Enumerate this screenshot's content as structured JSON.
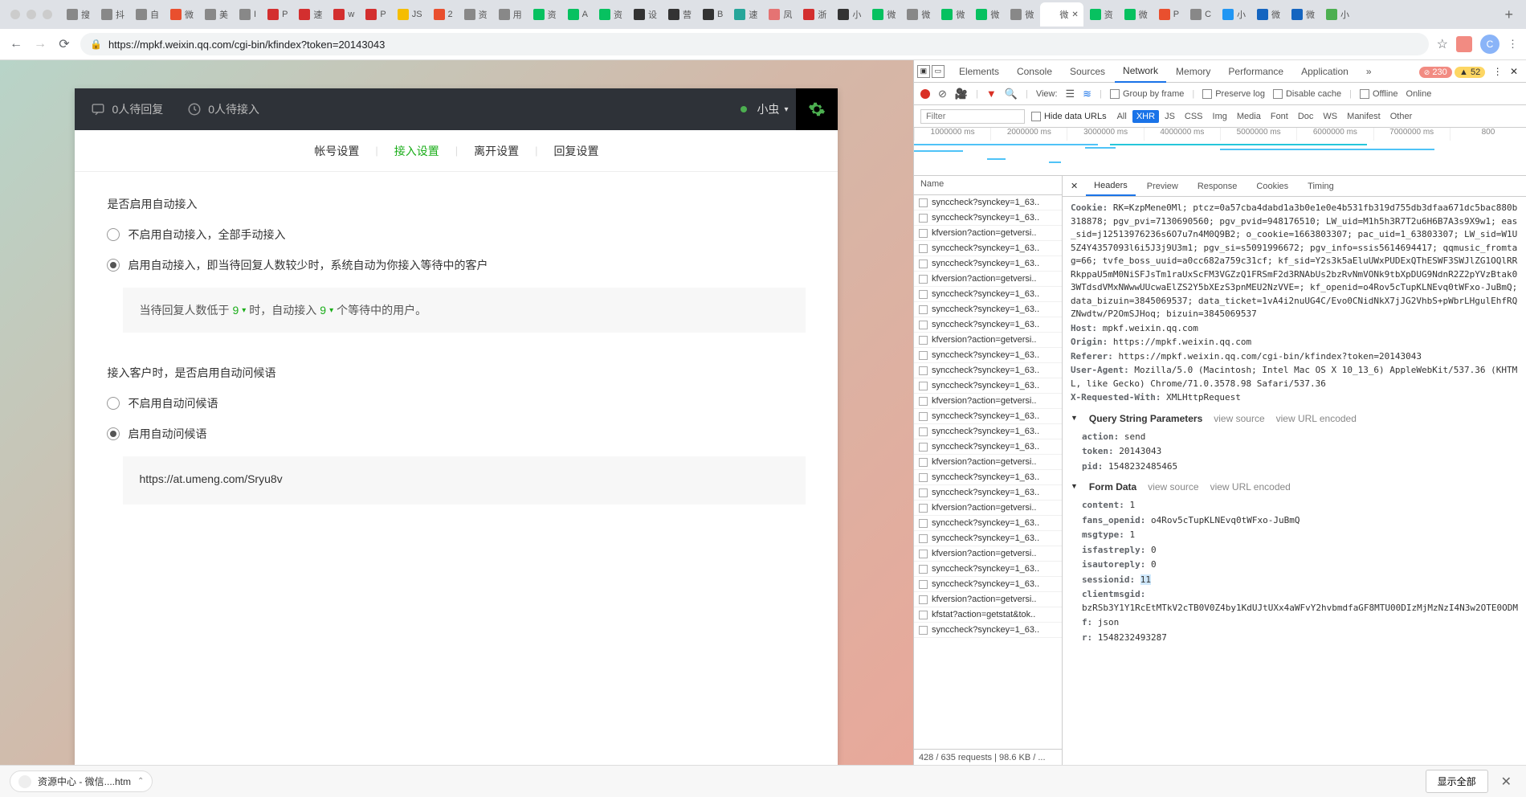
{
  "browser": {
    "url": "https://mpkf.weixin.qq.com/cgi-bin/kfindex?token=20143043",
    "avatar_letter": "C",
    "tab_add": "+",
    "tabs": [
      {
        "fav": "#888",
        "label": "搜"
      },
      {
        "fav": "#888",
        "label": "抖"
      },
      {
        "fav": "#888",
        "label": "自"
      },
      {
        "fav": "#e94f2e",
        "label": "微"
      },
      {
        "fav": "#888",
        "label": "美"
      },
      {
        "fav": "#888",
        "label": "I"
      },
      {
        "fav": "#d32f2f",
        "label": "P"
      },
      {
        "fav": "#d32f2f",
        "label": "速"
      },
      {
        "fav": "#d32f2f",
        "label": "w"
      },
      {
        "fav": "#d32f2f",
        "label": "P"
      },
      {
        "fav": "#f5bd00",
        "label": "JS"
      },
      {
        "fav": "#e94f2e",
        "label": "2"
      },
      {
        "fav": "#888",
        "label": "资"
      },
      {
        "fav": "#888",
        "label": "用"
      },
      {
        "fav": "#07c160",
        "label": "资"
      },
      {
        "fav": "#07c160",
        "label": "A"
      },
      {
        "fav": "#07c160",
        "label": "资"
      },
      {
        "fav": "#333",
        "label": "设"
      },
      {
        "fav": "#333",
        "label": "营"
      },
      {
        "fav": "#333",
        "label": "B"
      },
      {
        "fav": "#26a69a",
        "label": "速"
      },
      {
        "fav": "#e57373",
        "label": "凤"
      },
      {
        "fav": "#d32f2f",
        "label": "浙"
      },
      {
        "fav": "#333",
        "label": "小"
      },
      {
        "fav": "#07c160",
        "label": "微"
      },
      {
        "fav": "#888",
        "label": "微"
      },
      {
        "fav": "#07c160",
        "label": "微"
      },
      {
        "fav": "#07c160",
        "label": "微"
      },
      {
        "fav": "#888",
        "label": "微"
      },
      {
        "fav": "#fff",
        "label": "微",
        "active": true
      },
      {
        "fav": "#07c160",
        "label": "资"
      },
      {
        "fav": "#07c160",
        "label": "微"
      },
      {
        "fav": "#e94f2e",
        "label": "P"
      },
      {
        "fav": "#888",
        "label": "C"
      },
      {
        "fav": "#2196f3",
        "label": "小"
      },
      {
        "fav": "#1565c0",
        "label": "微"
      },
      {
        "fav": "#1565c0",
        "label": "微"
      },
      {
        "fav": "#4caf50",
        "label": "小"
      }
    ]
  },
  "app": {
    "header": {
      "pending_reply": "0人待回复",
      "pending_accept": "0人待接入",
      "username": "小虫"
    },
    "nav": {
      "tab1": "帐号设置",
      "tab2": "接入设置",
      "tab3": "离开设置",
      "tab4": "回复设置",
      "sep": "|"
    },
    "settings": {
      "auto_accept_title": "是否启用自动接入",
      "opt_manual": "不启用自动接入，全部手动接入",
      "opt_auto": "启用自动接入，即当待回复人数较少时，系统自动为你接入等待中的客户",
      "threshold_pre": "当待回复人数低于",
      "threshold_val": "9",
      "threshold_mid": "时，自动接入",
      "accept_count": "9",
      "threshold_post": "个等待中的用户。",
      "greeting_title": "接入客户时，是否启用自动问候语",
      "greeting_off": "不启用自动问候语",
      "greeting_on": "启用自动问候语",
      "greeting_text": "https://at.umeng.com/Sryu8v"
    }
  },
  "devtools": {
    "tabs": {
      "elements": "Elements",
      "console": "Console",
      "sources": "Sources",
      "network": "Network",
      "memory": "Memory",
      "performance": "Performance",
      "application": "Application",
      "more": "»"
    },
    "errors": "230",
    "warnings": "52",
    "toolbar": {
      "view": "View:",
      "group": "Group by frame",
      "preserve": "Preserve log",
      "disable_cache": "Disable cache",
      "offline": "Offline",
      "online": "Online"
    },
    "filter": {
      "placeholder": "Filter",
      "hide_urls": "Hide data URLs",
      "types": [
        "All",
        "XHR",
        "JS",
        "CSS",
        "Img",
        "Media",
        "Font",
        "Doc",
        "WS",
        "Manifest",
        "Other"
      ]
    },
    "waterfall_ticks": [
      "1000000 ms",
      "2000000 ms",
      "3000000 ms",
      "4000000 ms",
      "5000000 ms",
      "6000000 ms",
      "7000000 ms",
      "800"
    ],
    "reqlist": {
      "name_col": "Name",
      "rows": [
        "synccheck?synckey=1_63..",
        "synccheck?synckey=1_63..",
        "kfversion?action=getversi..",
        "synccheck?synckey=1_63..",
        "synccheck?synckey=1_63..",
        "kfversion?action=getversi..",
        "synccheck?synckey=1_63..",
        "synccheck?synckey=1_63..",
        "synccheck?synckey=1_63..",
        "kfversion?action=getversi..",
        "synccheck?synckey=1_63..",
        "synccheck?synckey=1_63..",
        "synccheck?synckey=1_63..",
        "kfversion?action=getversi..",
        "synccheck?synckey=1_63..",
        "synccheck?synckey=1_63..",
        "synccheck?synckey=1_63..",
        "kfversion?action=getversi..",
        "synccheck?synckey=1_63..",
        "synccheck?synckey=1_63..",
        "kfversion?action=getversi..",
        "synccheck?synckey=1_63..",
        "synccheck?synckey=1_63..",
        "kfversion?action=getversi..",
        "synccheck?synckey=1_63..",
        "synccheck?synckey=1_63..",
        "kfversion?action=getversi..",
        "kfstat?action=getstat&tok..",
        "synccheck?synckey=1_63.."
      ],
      "footer": "428 / 635 requests | 98.6 KB / ..."
    },
    "detail_tabs": {
      "headers": "Headers",
      "preview": "Preview",
      "response": "Response",
      "cookies": "Cookies",
      "timing": "Timing"
    },
    "headers": {
      "cookie_key": "Cookie:",
      "cookie_val": "RK=KzpMene0Ml; ptcz=0a57cba4dabd1a3b0e1e0e4b531fb319d755db3dfaa671dc5bac880b318878; pgv_pvi=7130690560; pgv_pvid=948176510; LW_uid=M1h5h3R7T2u6H6B7A3s9X9w1; eas_sid=j12513976236s6O7u7n4M0Q9B2; o_cookie=1663803307; pac_uid=1_63803307; LW_sid=W1U5Z4Y4357093l6i5J3j9U3m1; pgv_si=s5091996672; pgv_info=ssis5614694417; qqmusic_fromtag=66; tvfe_boss_uuid=a0cc682a759c31cf; kf_sid=Y2s3k5aEluUWxPUDExQThESWF3SWJlZG1OQlRRRkppaU5mM0NiSFJsTm1raUxScFM3VGZzQ1FRSmF2d3RNAbUs2bzRvNmVONk9tbXpDUG9NdnR2Z2pYVzBtak03WTdsdVMxNWwwUUcwaElZS2Y5bXEzS3pnMEU2NzVVE=; kf_openid=o4Rov5cTupKLNEvq0tWFxo-JuBmQ; data_bizuin=3845069537; data_ticket=1vA4i2nuUG4C/Evo0CNidNkX7jJG2VhbS+pWbrLHgulEhfRQZNwdtw/P2OmSJHoq; bizuin=3845069537",
      "host_key": "Host:",
      "host_val": "mpkf.weixin.qq.com",
      "origin_key": "Origin:",
      "origin_val": "https://mpkf.weixin.qq.com",
      "referer_key": "Referer:",
      "referer_val": "https://mpkf.weixin.qq.com/cgi-bin/kfindex?token=20143043",
      "ua_key": "User-Agent:",
      "ua_val": "Mozilla/5.0 (Macintosh; Intel Mac OS X 10_13_6) AppleWebKit/537.36 (KHTML, like Gecko) Chrome/71.0.3578.98 Safari/537.36",
      "xrw_key": "X-Requested-With:",
      "xrw_val": "XMLHttpRequest"
    },
    "sections": {
      "query": "Query String Parameters",
      "form": "Form Data",
      "view_source": "view source",
      "view_url": "view URL encoded"
    },
    "query_params": [
      {
        "k": "action:",
        "v": "send"
      },
      {
        "k": "token:",
        "v": "20143043"
      },
      {
        "k": "pid:",
        "v": "1548232485465"
      }
    ],
    "form_data": [
      {
        "k": "content:",
        "v": "1"
      },
      {
        "k": "fans_openid:",
        "v": "o4Rov5cTupKLNEvq0tWFxo-JuBmQ"
      },
      {
        "k": "msgtype:",
        "v": "1"
      },
      {
        "k": "isfastreply:",
        "v": "0"
      },
      {
        "k": "isautoreply:",
        "v": "0"
      },
      {
        "k": "sessionid:",
        "v": "11",
        "hl": true
      },
      {
        "k": "clientmsgid:",
        "v": "bzRSb3Y1Y1RcEtMTkV2cTB0V0Z4by1KdUJtUXx4aWFvY2hvbmdfaGF8MTU00DIzMjMzNzI4N3w2OTE0ODM"
      },
      {
        "k": "f:",
        "v": "json"
      },
      {
        "k": "r:",
        "v": "1548232493287"
      }
    ]
  },
  "download": {
    "item": "资源中心 - 微信....htm",
    "show_all": "显示全部"
  }
}
